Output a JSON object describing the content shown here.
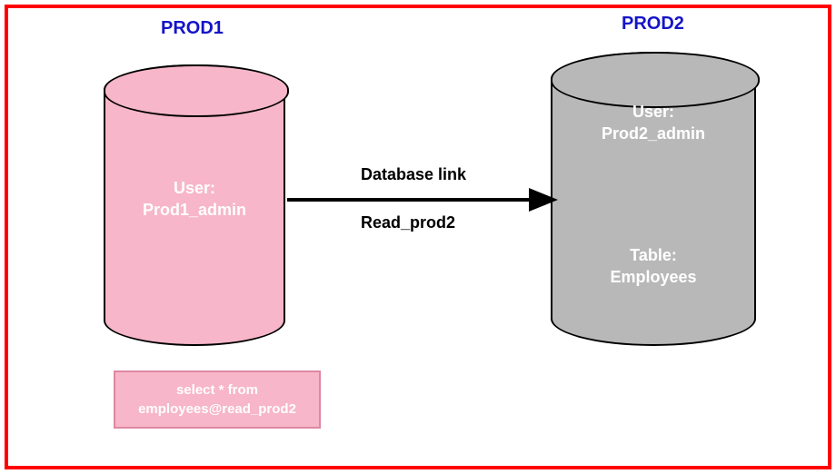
{
  "db_left": {
    "title": "PROD1",
    "user_label": "User:",
    "user_name": "Prod1_admin"
  },
  "db_right": {
    "title": "PROD2",
    "user_label": "User:",
    "user_name": "Prod2_admin",
    "table_label": "Table:",
    "table_name": "Employees"
  },
  "link": {
    "title": "Database link",
    "name": "Read_prod2"
  },
  "query": {
    "line1": "select * from",
    "line2": "employees@read_prod2"
  }
}
